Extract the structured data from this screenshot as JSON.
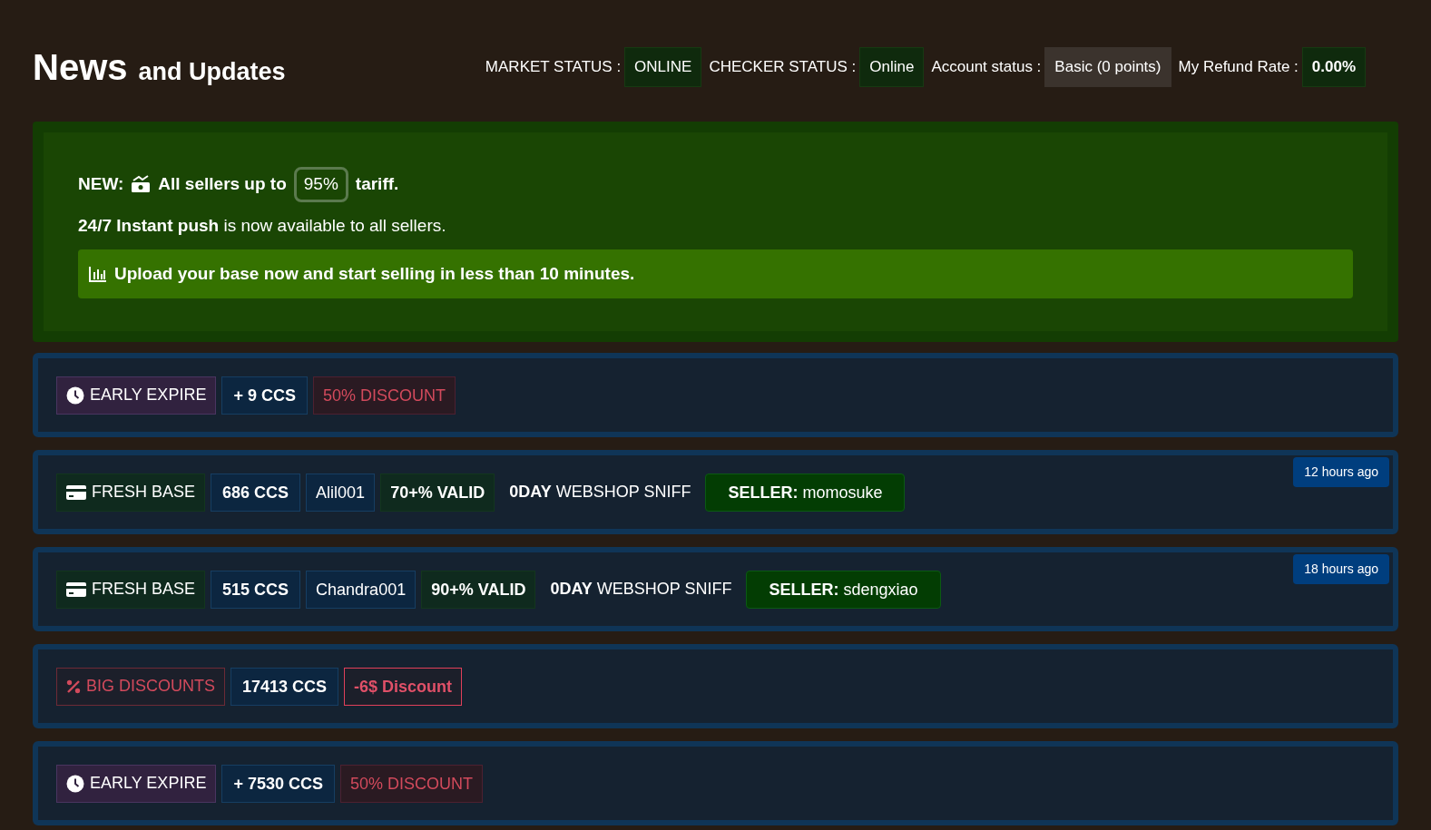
{
  "header": {
    "title_main": "News",
    "title_rest": "and Updates"
  },
  "status_bar": [
    {
      "label": "MARKET STATUS :",
      "value": "ONLINE",
      "kind": "online"
    },
    {
      "label": "CHECKER STATUS :",
      "value": "Online",
      "kind": "online"
    },
    {
      "label": "Account status :",
      "value": "Basic (0 points)",
      "kind": "neutral"
    },
    {
      "label": "My Refund Rate :",
      "value": "0.00%",
      "kind": "strong"
    }
  ],
  "announcement": {
    "prefix": "NEW:",
    "before": "All sellers up to",
    "highlight": "95%",
    "after": "tariff.",
    "line2": "**24/7 Instant push** is now available to all sellers.",
    "callout": "Upload your base now and start selling in less than 10 minutes."
  },
  "news": [
    {
      "tags": [
        {
          "kind": "expire",
          "text": "EARLY EXPIRE"
        },
        {
          "kind": "count",
          "text": "+ 9 CCS"
        },
        {
          "kind": "discount",
          "text": "50% DISCOUNT"
        }
      ]
    },
    {
      "time": "12 hours ago",
      "tags": [
        {
          "kind": "fresh",
          "text": "FRESH BASE"
        },
        {
          "kind": "count",
          "text": "686 CCS"
        },
        {
          "kind": "id",
          "text": "Alil001"
        },
        {
          "kind": "valid",
          "text": "70+% VALID"
        },
        {
          "kind": "plain",
          "text": "**0DAY** WEBSHOP SNIFF"
        },
        {
          "kind": "seller",
          "text": "**SELLER:** momosuke"
        }
      ]
    },
    {
      "time": "18 hours ago",
      "tags": [
        {
          "kind": "fresh",
          "text": "FRESH BASE"
        },
        {
          "kind": "count",
          "text": "515 CCS"
        },
        {
          "kind": "id",
          "text": "Chandra001"
        },
        {
          "kind": "valid",
          "text": "90+% VALID"
        },
        {
          "kind": "plain",
          "text": "**0DAY** WEBSHOP SNIFF"
        },
        {
          "kind": "seller",
          "text": "**SELLER:** sdengxiao"
        }
      ]
    },
    {
      "tags": [
        {
          "kind": "bigdiscount",
          "text": "BIG DISCOUNTS"
        },
        {
          "kind": "count",
          "text": "17413 CCS"
        },
        {
          "kind": "outline",
          "text": "-6$ Discount"
        }
      ]
    },
    {
      "tags": [
        {
          "kind": "expire",
          "text": "EARLY EXPIRE"
        },
        {
          "kind": "count",
          "text": "+ 7530 CCS"
        },
        {
          "kind": "discount",
          "text": "50% DISCOUNT"
        }
      ]
    }
  ]
}
